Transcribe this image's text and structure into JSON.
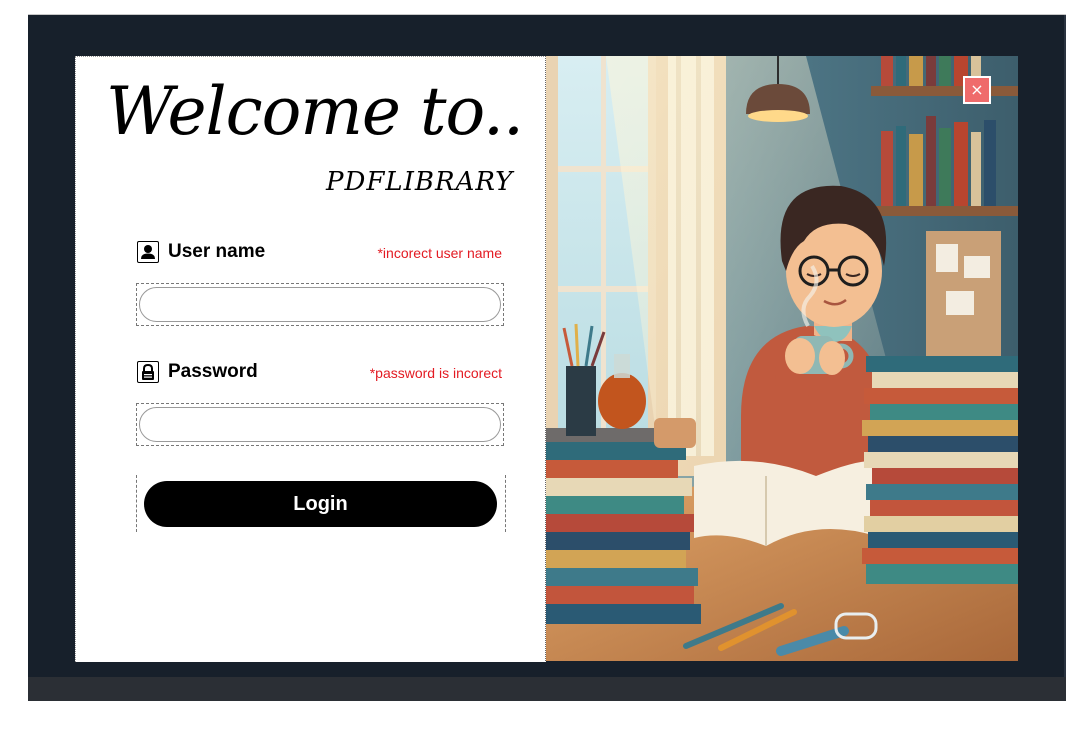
{
  "welcome": {
    "title": "Welcome to..",
    "subtitle": "PDFLIBRARY"
  },
  "username": {
    "label": "User name",
    "error": "*incorect user name",
    "value": "",
    "icon": "user-icon"
  },
  "password": {
    "label": "Password",
    "error": "*password is incorect",
    "value": "",
    "icon": "lock-icon"
  },
  "login": {
    "label": "Login"
  },
  "close": {
    "label": "×",
    "icon": "close-icon"
  },
  "colors": {
    "background": "#17202b",
    "error": "#e31b23",
    "button": "#000000",
    "close": "#ef6b6b"
  }
}
